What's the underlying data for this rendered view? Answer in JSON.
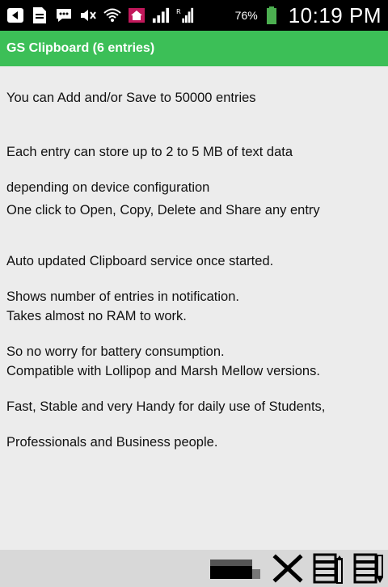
{
  "status_bar": {
    "battery_percent": "76%",
    "time": "10:19 PM",
    "icons": [
      "back-arrow-icon",
      "document-icon",
      "chat-icon",
      "mute-icon",
      "wifi-icon",
      "home-icon",
      "signal-icon",
      "roaming-signal-icon",
      "battery-icon"
    ]
  },
  "app": {
    "title": "GS Clipboard (6 entries)",
    "accent_color": "#3cbf57"
  },
  "entries": [
    {
      "lines": [
        "You can Add and/or Save to 50000 entries"
      ]
    },
    {
      "lines": [
        "Each entry can store up to 2 to 5 MB of text data",
        "depending on device configuration"
      ]
    },
    {
      "lines": [
        "One click to Open, Copy, Delete and Share any entry"
      ]
    },
    {
      "lines": [
        "Auto updated Clipboard service once started.",
        "Shows number of entries in notification."
      ]
    },
    {
      "lines": [
        "Takes almost no RAM to work.",
        "So no worry for battery consumption."
      ]
    },
    {
      "lines": [
        "Compatible with Lollipop and Marsh Mellow versions.",
        "Fast, Stable and very Handy for daily use of Students,",
        "Professionals and Business people."
      ]
    }
  ],
  "toolbar": {
    "icons": [
      "eraser-icon",
      "close-icon",
      "import-icon",
      "export-icon"
    ]
  }
}
